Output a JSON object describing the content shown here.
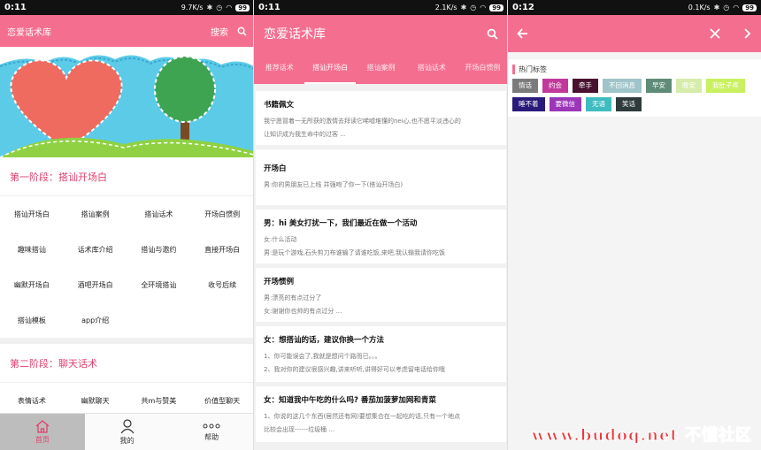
{
  "panel1": {
    "status": {
      "time": "0:11",
      "speed": "9.7K/s",
      "battery": "99"
    },
    "header": {
      "title": "恋爱话术库",
      "search_label": "搜索"
    },
    "stage1": {
      "title": "第一阶段：搭讪开场白"
    },
    "grid1": [
      "搭讪开场白",
      "搭讪案例",
      "搭讪话术",
      "开场白惯例",
      "趣味搭讪",
      "话术库介绍",
      "搭讪与邀约",
      "直接开场白",
      "幽默开场白",
      "酒吧开场白",
      "全环境搭讪",
      "收号后续",
      "搭讪模板",
      "app介绍"
    ],
    "stage2": {
      "title": "第二阶段：聊天话术"
    },
    "grid2": [
      "表情话术",
      "幽默聊天",
      "共m与赞美",
      "价值型聊天"
    ],
    "tabs": [
      {
        "label": "首页",
        "icon": "home-icon"
      },
      {
        "label": "我的",
        "icon": "user-icon"
      },
      {
        "label": "帮助",
        "icon": "more-dots-icon"
      }
    ]
  },
  "panel2": {
    "status": {
      "time": "0:11",
      "speed": "2.1K/s",
      "battery": "99"
    },
    "header": {
      "title": "恋爱话术库"
    },
    "tabs": [
      "推荐话术",
      "搭讪开场白",
      "搭讪案例",
      "搭讪话术",
      "开场白惯例"
    ],
    "active_tab": 1,
    "cards": [
      {
        "title": "书籍佩文",
        "lines": [
          "我宁愿冒着一无所获的激情去拜读它唏嘘堆懂的nei心,也不愿平淡违心的",
          "让知识成为我生命中的过客 ..."
        ]
      },
      {
        "title": "开场白",
        "lines": [
          "男:你的男朋友已上线 并强吻了你一下(搭讪开场白)"
        ]
      },
      {
        "title": "男：hi 美女打扰一下，我们最近在做一个活动",
        "lines": [
          "女:什么活动",
          "男:是玩个游戏,石头剪刀布谁输了请谁吃饭,来吧,我认输我请你吃饭"
        ]
      },
      {
        "title": "开场惯例",
        "lines": [
          "男:漂亮的有点过分了",
          "女:谢谢你也帅的有点过分 ..."
        ]
      },
      {
        "title": "女：想搭讪的话，建议你换一个方法",
        "lines": [
          "1、你可能误会了,我就是想问个路而已。。。",
          "2、我对你的建议很感兴趣,讲来听听,讲得好可以考虑留电话给你哦"
        ]
      },
      {
        "title": "女：知道我中午吃的什么吗? 番茄加菠萝加网和青菜",
        "lines": [
          "1、你说的这几个东西(居然还有网)要想集合在一起吃的话,只有一个地点",
          "比较会出现------垃圾桶 ..."
        ]
      }
    ]
  },
  "panel3": {
    "status": {
      "time": "0:12",
      "speed": "0.1K/s",
      "battery": "99"
    },
    "hot_title": "热门标签",
    "tags": [
      {
        "label": "情话",
        "color": "#7b7b7b"
      },
      {
        "label": "约会",
        "color": "#c2399c"
      },
      {
        "label": "牵手",
        "color": "#4a1230"
      },
      {
        "label": "不回消息",
        "color": "#9fc4c9"
      },
      {
        "label": "早安",
        "color": "#5f8c78"
      },
      {
        "label": "晚安",
        "color": "#d6ecaa"
      },
      {
        "label": "我肚子疼",
        "color": "#c8f060"
      },
      {
        "label": "睡不着",
        "color": "#2a1a7a"
      },
      {
        "label": "要微信",
        "color": "#9b36b8"
      },
      {
        "label": "无语",
        "color": "#3fbcc0"
      },
      {
        "label": "笑话",
        "color": "#2f3b3b"
      }
    ]
  },
  "watermark": "www.budoq.net 不懂社区"
}
